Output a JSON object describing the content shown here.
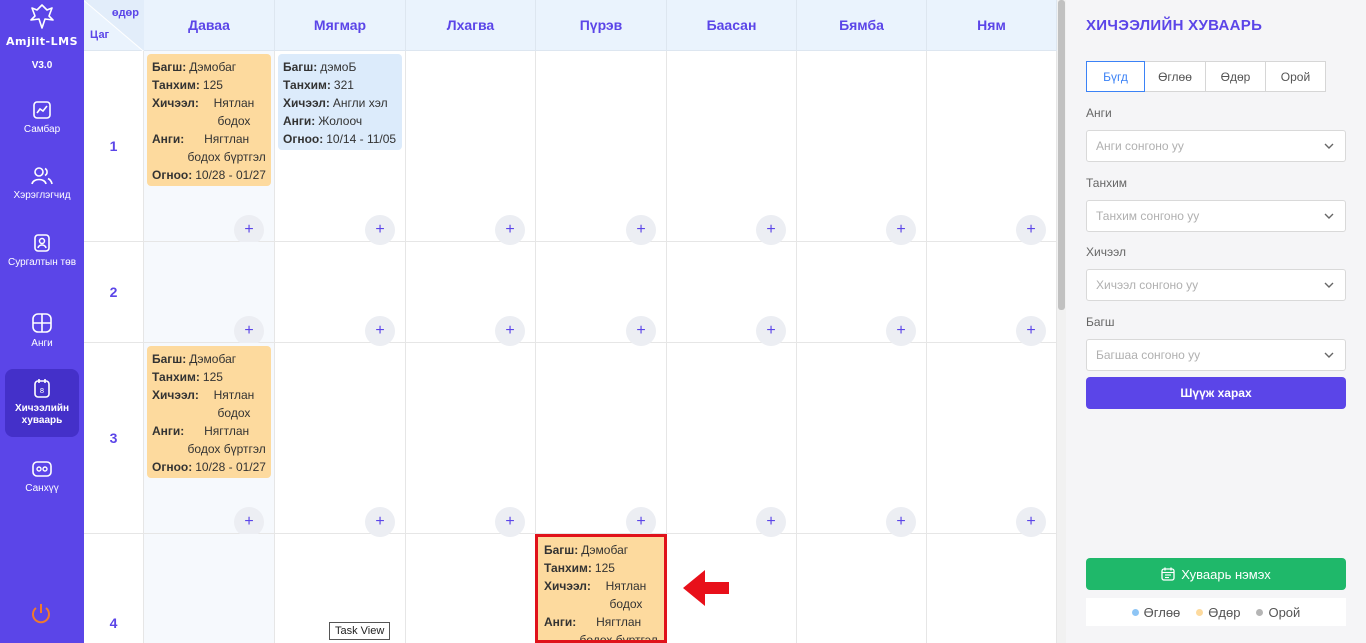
{
  "sidebar": {
    "brand": "Amjilt-LMS",
    "version": "V3.0",
    "items": [
      {
        "label": "Самбар",
        "icon": "chart-icon"
      },
      {
        "label": "Хэрэглэгчид",
        "icon": "users-icon"
      },
      {
        "label": "Сургалтын төв",
        "icon": "id-badge-icon"
      },
      {
        "label": "Анги",
        "icon": "grid-icon"
      },
      {
        "label": "Хичээлийн хуваарь",
        "icon": "calendar-icon",
        "active": true
      },
      {
        "label": "Санхүү",
        "icon": "wallet-icon"
      }
    ],
    "accent": "#5B45E8"
  },
  "grid": {
    "corner_top": "өдөр",
    "corner_bottom": "Цаг",
    "days": [
      "Даваа",
      "Мягмар",
      "Лхагва",
      "Пүрэв",
      "Баасан",
      "Бямба",
      "Ням"
    ],
    "rows": [
      "1",
      "2",
      "3",
      "4"
    ],
    "add_symbol": "+"
  },
  "cards": {
    "c1": {
      "teacher_label": "Багш:",
      "teacher": "Дэмобаг",
      "room_label": "Танхим:",
      "room": "125",
      "subject_label": "Хичээл:",
      "subject": "Нятлан бодох",
      "class_label": "Анги:",
      "class": "Нягтлан бодох бүртгэл",
      "date_label": "Огноо:",
      "date": "10/28 - 01/27"
    },
    "c2": {
      "teacher_label": "Багш:",
      "teacher": "дэмоБ",
      "room_label": "Танхим:",
      "room": "321",
      "subject_label": "Хичээл:",
      "subject": "Англи хэл",
      "class_label": "Анги:",
      "class": "Жолооч",
      "date_label": "Огноо:",
      "date": "10/14 - 11/05"
    },
    "c3": {
      "teacher_label": "Багш:",
      "teacher": "Дэмобаг",
      "room_label": "Танхим:",
      "room": "125",
      "subject_label": "Хичээл:",
      "subject": "Нятлан бодох",
      "class_label": "Анги:",
      "class": "Нягтлан бодох бүртгэл",
      "date_label": "Огноо:",
      "date": "10/28 - 01/27"
    },
    "c4": {
      "teacher_label": "Багш:",
      "teacher": "Дэмобаг",
      "room_label": "Танхим:",
      "room": "125",
      "subject_label": "Хичээл:",
      "subject": "Нятлан бодох",
      "class_label": "Анги:",
      "class": "Нягтлан бодох бүртгэл"
    }
  },
  "tooltip": "Task View",
  "panel": {
    "title": "ХИЧЭЭЛИЙН ХУВААРЬ",
    "tabs": [
      "Бүгд",
      "Өглөө",
      "Өдөр",
      "Орой"
    ],
    "active_tab": "Бүгд",
    "filters": [
      {
        "label": "Анги",
        "placeholder": "Анги сонгоно уу"
      },
      {
        "label": "Танхим",
        "placeholder": "Танхим сонгоно уу"
      },
      {
        "label": "Хичээл",
        "placeholder": "Хичээл сонгоно уу"
      },
      {
        "label": "Багш",
        "placeholder": "Багшаа сонгоно уу"
      }
    ],
    "filter_button": "Шүүж харах",
    "add_button": "Хуваарь нэмэх",
    "legend": [
      {
        "label": "Өглөө",
        "color": "#8EC5F5"
      },
      {
        "label": "Өдөр",
        "color": "#FDDA9E"
      },
      {
        "label": "Орой",
        "color": "#B5B5B5"
      }
    ]
  }
}
